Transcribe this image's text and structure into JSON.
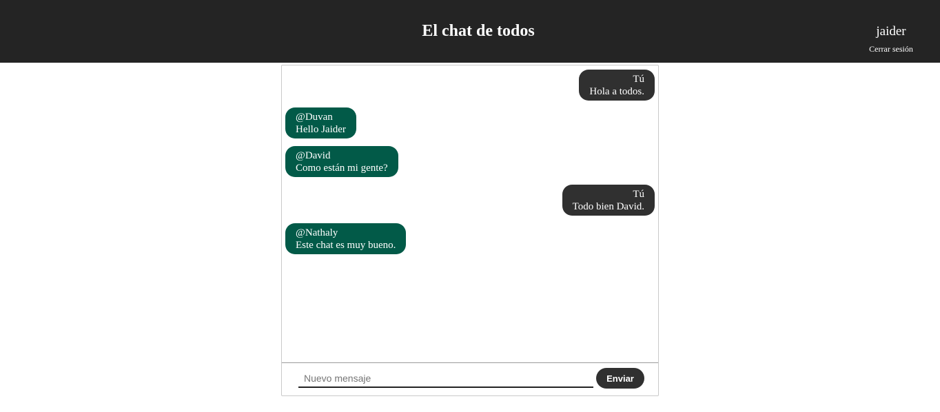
{
  "header": {
    "title": "El chat de todos",
    "username": "jaider",
    "logout_label": "Cerrar sesión"
  },
  "messages": [
    {
      "direction": "out",
      "author": "Tú",
      "text": "Hola a todos."
    },
    {
      "direction": "in",
      "author": "@Duvan",
      "text": "Hello Jaider"
    },
    {
      "direction": "in",
      "author": "@David",
      "text": "Como están mi gente?"
    },
    {
      "direction": "out",
      "author": "Tú",
      "text": "Todo bien David."
    },
    {
      "direction": "in",
      "author": "@Nathaly",
      "text": "Este chat es muy bueno."
    }
  ],
  "composer": {
    "placeholder": "Nuevo mensaje",
    "value": "",
    "send_label": "Enviar"
  },
  "colors": {
    "header_bg": "#242424",
    "outgoing_bubble": "#303030",
    "incoming_bubble": "#025a48",
    "send_button": "#303030"
  }
}
